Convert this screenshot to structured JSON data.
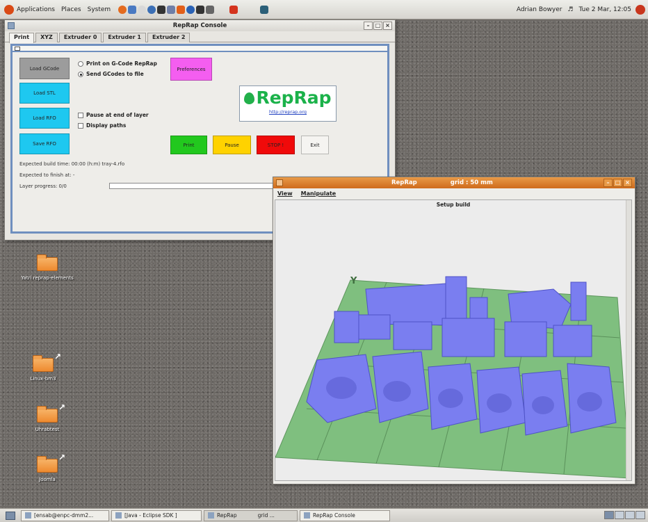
{
  "top_panel": {
    "menus": [
      "Applications",
      "Places",
      "System"
    ],
    "user": "Adrian Bowyer",
    "clock": "Tue  2 Mar, 12:05"
  },
  "console": {
    "title": "RepRap Console",
    "tabs": [
      "Print",
      "XYZ",
      "Extruder 0",
      "Extruder 1",
      "Extruder 2"
    ],
    "buttons": {
      "load_gcode": "Load GCode",
      "load_stl": "Load STL",
      "load_rfo": "Load RFO",
      "save_rfo": "Save RFO",
      "preferences": "Preferences",
      "print": "Print",
      "pause": "Pause",
      "stop": "STOP !",
      "exit": "Exit"
    },
    "radios": {
      "print_on_repRap": "Print on G-Code RepRap",
      "send_to_file": "Send GCodes to file"
    },
    "checks": {
      "pause_end_layer": "Pause at end of layer",
      "display_paths": "Display paths"
    },
    "logo": {
      "text": "RepRap",
      "url": "http://reprap.org"
    },
    "status": {
      "build_time": "Expected build time:  00:00   (h:m)  tray-4.rfo",
      "finish_at": "Expected to finish at:   -",
      "layer_progress": "Layer progress:  0/0"
    },
    "colors": {
      "cyan": "#1ec8f0",
      "gray": "#9c9c9c",
      "magenta": "#f45ef0",
      "green": "#22c81e",
      "yellow": "#ffd200",
      "red": "#f00a0a",
      "logo_green": "#1bb24a",
      "frame_blue": "#6f8fbf"
    }
  },
  "desktop": {
    "icons": [
      "Yatri reprap-elements",
      "Linux-bm3",
      "Uhrabtest",
      "Joomla"
    ]
  },
  "view3d": {
    "title": "RepRap",
    "subtitle": "grid : 50 mm",
    "menus": [
      "View",
      "Manipulate"
    ],
    "canvas_title": "Setup build",
    "colors": {
      "bed": "#7fbf7f",
      "parts": "#7a7ef0",
      "parts_dark": "#5a5ed0"
    }
  },
  "taskbar": {
    "tasks": [
      "[ensab@enpc-dmm2...",
      "[Java - Eclipse SDK ]",
      "RepRap",
      "grid ...",
      "RepRap Console"
    ]
  }
}
